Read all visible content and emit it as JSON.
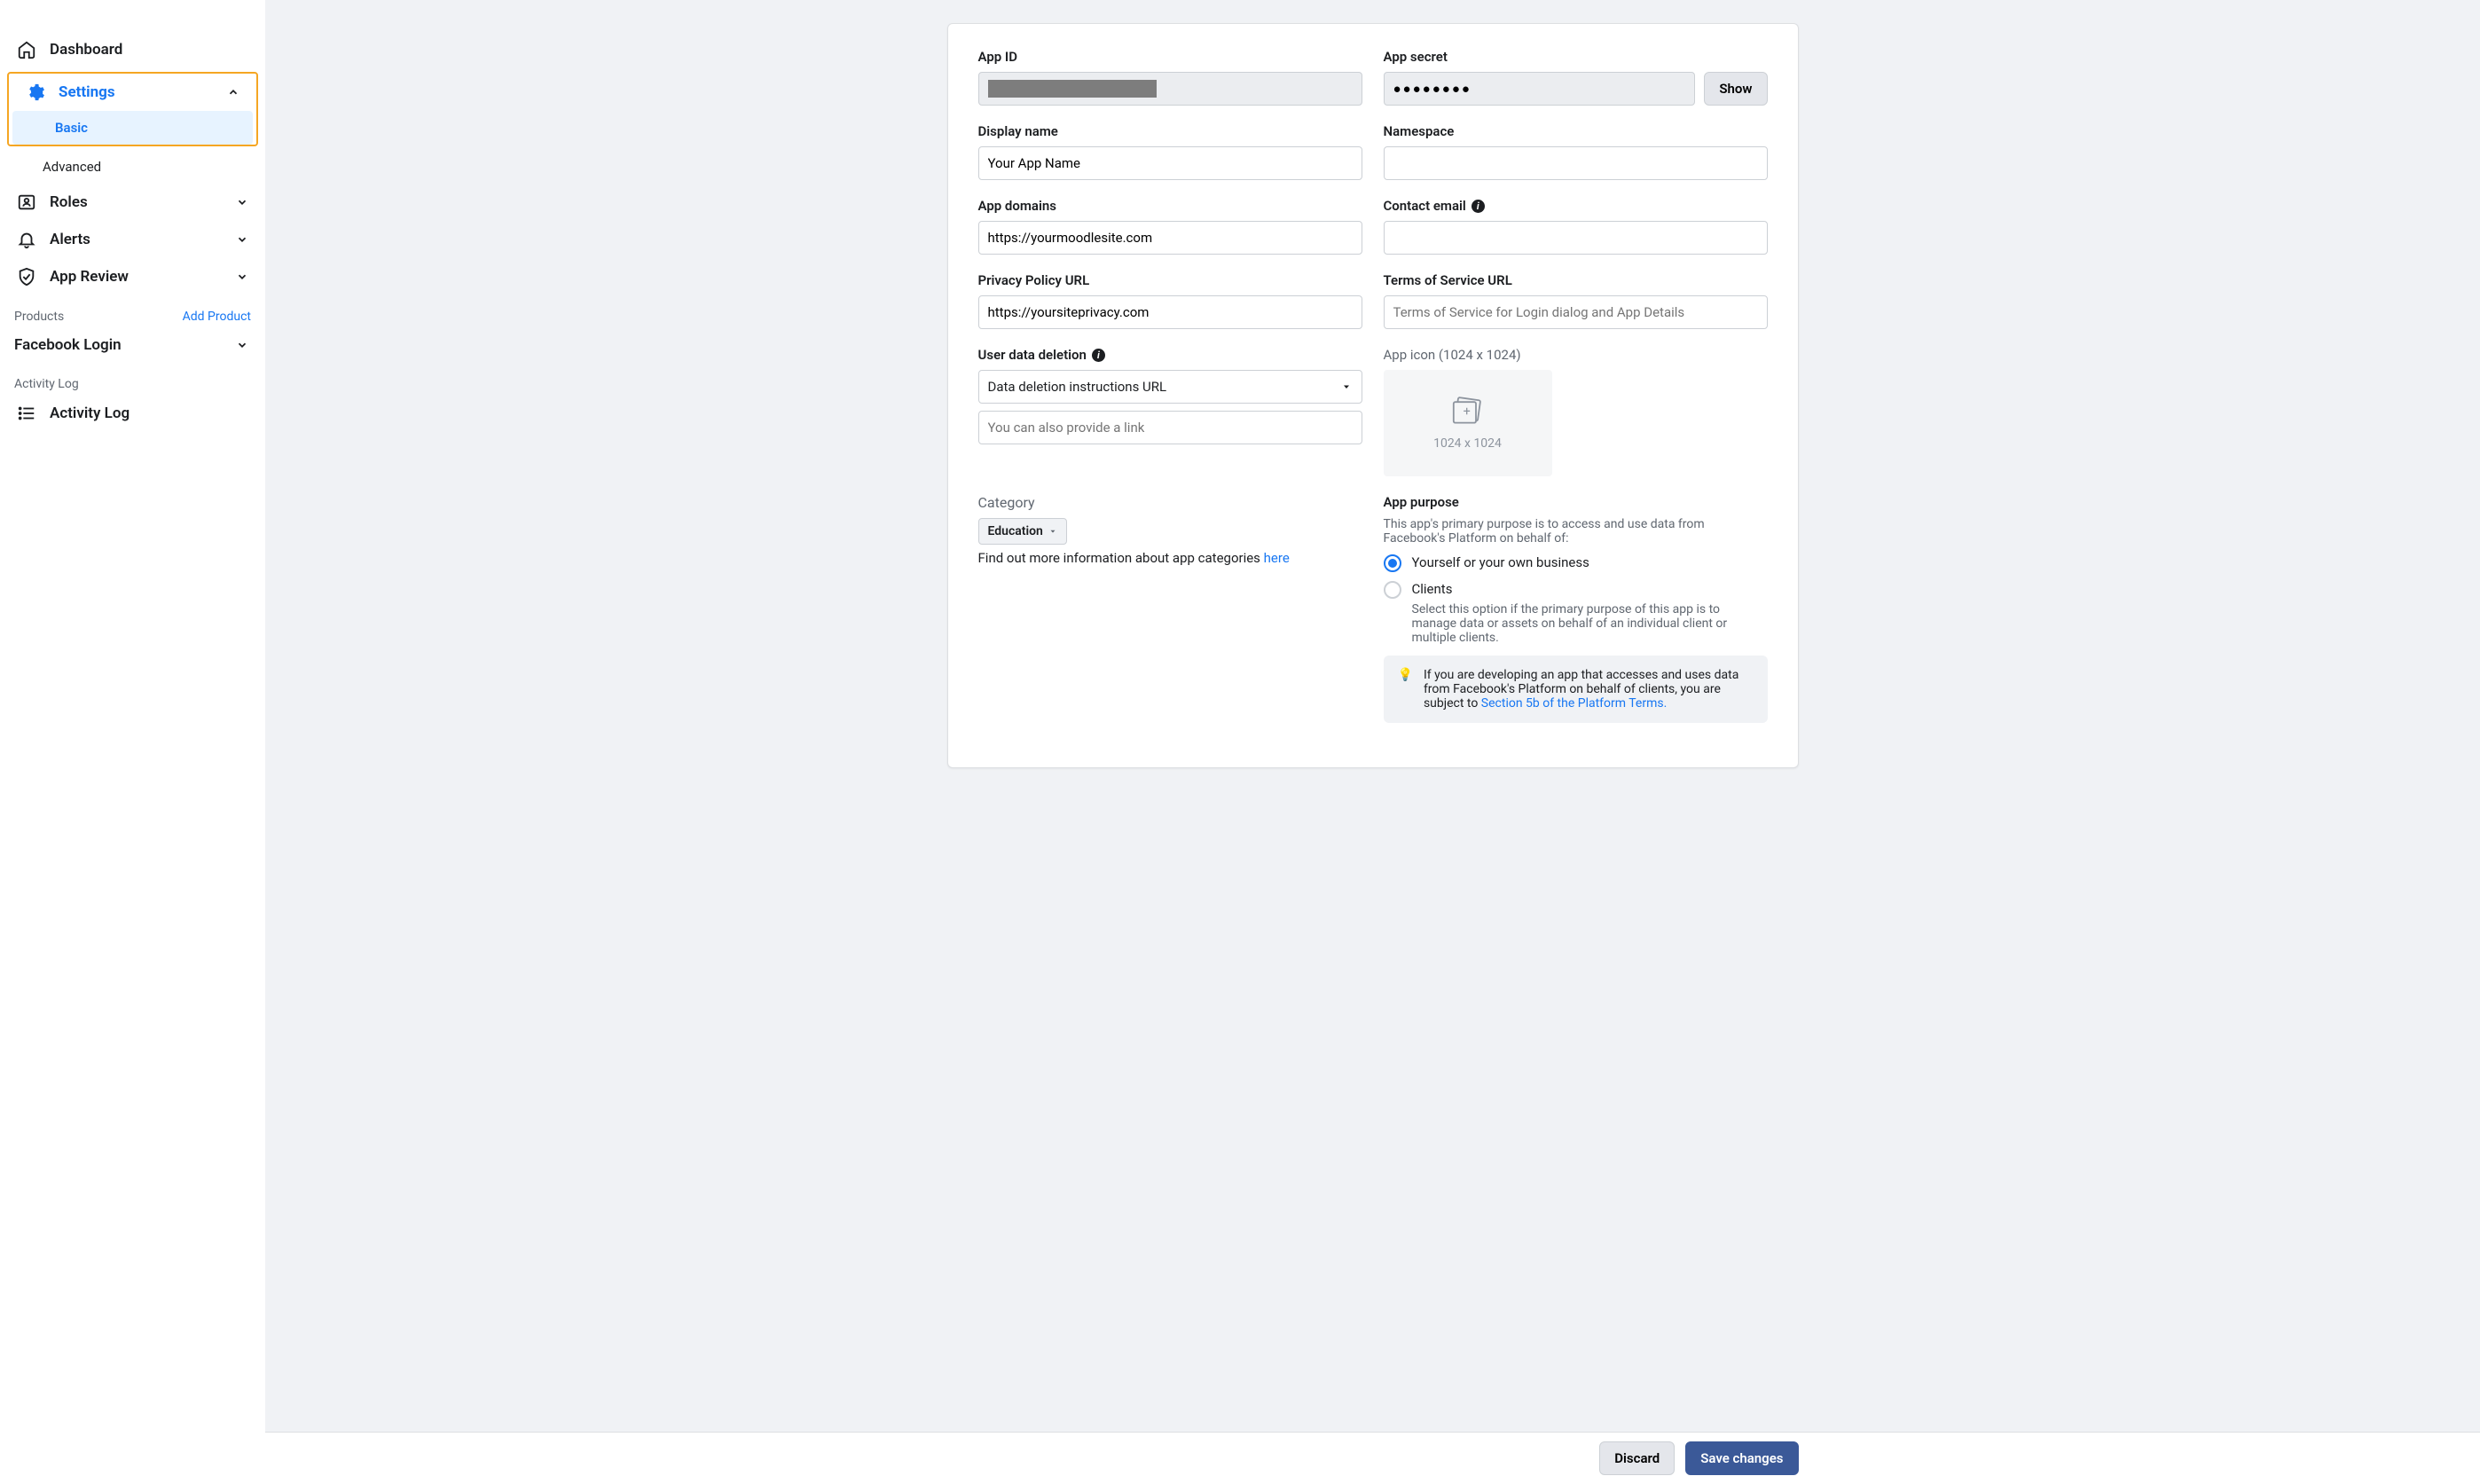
{
  "sidebar": {
    "dashboard": "Dashboard",
    "settings": "Settings",
    "basic": "Basic",
    "advanced": "Advanced",
    "roles": "Roles",
    "alerts": "Alerts",
    "app_review": "App Review",
    "products_label": "Products",
    "add_product": "Add Product",
    "facebook_login": "Facebook Login",
    "activity_log_section": "Activity Log",
    "activity_log": "Activity Log"
  },
  "form": {
    "app_id_label": "App ID",
    "app_secret_label": "App secret",
    "app_secret_value": "●●●●●●●●",
    "show_btn": "Show",
    "display_name_label": "Display name",
    "display_name_value": "Your App Name",
    "namespace_label": "Namespace",
    "app_domains_label": "App domains",
    "app_domains_value": "https://yourmoodlesite.com",
    "contact_email_label": "Contact email",
    "privacy_label": "Privacy Policy URL",
    "privacy_value": "https://yoursiteprivacy.com",
    "tos_label": "Terms of Service URL",
    "tos_placeholder": "Terms of Service for Login dialog and App Details",
    "user_data_deletion_label": "User data deletion",
    "user_data_deletion_select": "Data deletion instructions URL",
    "user_data_deletion_placeholder": "You can also provide a link",
    "app_icon_label": "App icon (1024 x 1024)",
    "app_icon_size": "1024 x 1024",
    "category_label": "Category",
    "category_value": "Education",
    "category_help_prefix": "Find out more information about app categories ",
    "category_help_link": "here",
    "app_purpose_label": "App purpose",
    "app_purpose_desc": "This app's primary purpose is to access and use data from Facebook's Platform on behalf of:",
    "purpose_self": "Yourself or your own business",
    "purpose_clients": "Clients",
    "purpose_clients_desc": "Select this option if the primary purpose of this app is to manage data or assets on behalf of an individual client or multiple clients.",
    "hint_text": "If you are developing an app that accesses and uses data from Facebook's Platform on behalf of clients, you are subject to ",
    "hint_link": "Section 5b of the Platform Terms."
  },
  "footer": {
    "discard": "Discard",
    "save": "Save changes"
  }
}
